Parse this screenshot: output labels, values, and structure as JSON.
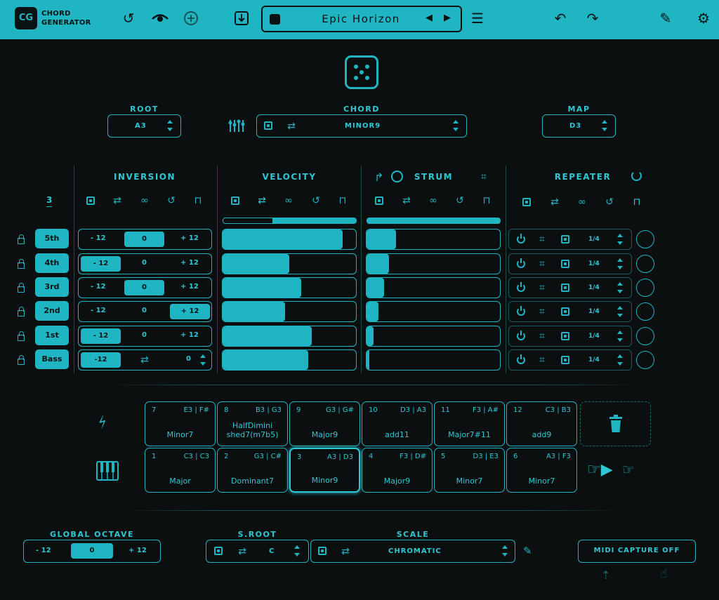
{
  "app": {
    "logo": "CG",
    "name_line1": "CHORD",
    "name_line2": "GENERATOR"
  },
  "preset": {
    "name": "Epic Horizon"
  },
  "root": {
    "label": "ROOT",
    "value": "A3"
  },
  "chord": {
    "label": "CHORD",
    "value": "MINOR9"
  },
  "map": {
    "label": "MAP",
    "value": "D3"
  },
  "sections": {
    "inversion": "INVERSION",
    "velocity": "VELOCITY",
    "strum": "STRUM",
    "repeater": "REPEATER"
  },
  "voice_count": "3",
  "voices": [
    {
      "label": "5th",
      "inv_low": "- 12",
      "inv_mid": "0",
      "inv_high": "+ 12",
      "inv_selected": "mid",
      "velocity": 0.9,
      "strum": 0.22,
      "rate": "1/4"
    },
    {
      "label": "4th",
      "inv_low": "- 12",
      "inv_mid": "0",
      "inv_high": "+ 12",
      "inv_selected": "low",
      "velocity": 0.5,
      "strum": 0.17,
      "rate": "1/4"
    },
    {
      "label": "3rd",
      "inv_low": "- 12",
      "inv_mid": "0",
      "inv_high": "+ 12",
      "inv_selected": "mid",
      "velocity": 0.59,
      "strum": 0.13,
      "rate": "1/4"
    },
    {
      "label": "2nd",
      "inv_low": "- 12",
      "inv_mid": "0",
      "inv_high": "+ 12",
      "inv_selected": "high",
      "velocity": 0.47,
      "strum": 0.09,
      "rate": "1/4"
    },
    {
      "label": "1st",
      "inv_low": "- 12",
      "inv_mid": "0",
      "inv_high": "+ 12",
      "inv_selected": "low",
      "velocity": 0.67,
      "strum": 0.05,
      "rate": "1/4"
    },
    {
      "label": "Bass",
      "inv_low": "-12",
      "inv_mid": "",
      "inv_high": "0",
      "inv_selected": "low",
      "velocity": 0.64,
      "strum": 0.0,
      "rate": "1/4"
    }
  ],
  "velocity_range": 0.37,
  "pads_top": [
    {
      "num": "7",
      "notes": "E3 | F#",
      "name": "Minor7"
    },
    {
      "num": "8",
      "notes": "B3 | G3",
      "name": "HalfDimini shed7(m7b5)"
    },
    {
      "num": "9",
      "notes": "G3 | G#",
      "name": "Major9"
    },
    {
      "num": "10",
      "notes": "D3 | A3",
      "name": "add11"
    },
    {
      "num": "11",
      "notes": "F3 | A#",
      "name": "Major7#11"
    },
    {
      "num": "12",
      "notes": "C3 | B3",
      "name": "add9"
    }
  ],
  "pads_bottom": [
    {
      "num": "1",
      "notes": "C3 | C3",
      "name": "Major"
    },
    {
      "num": "2",
      "notes": "G3 | C#",
      "name": "Dominant7"
    },
    {
      "num": "3",
      "notes": "A3 | D3",
      "name": "Minor9"
    },
    {
      "num": "4",
      "notes": "F3 | D#",
      "name": "Major9"
    },
    {
      "num": "5",
      "notes": "D3 | E3",
      "name": "Minor7"
    },
    {
      "num": "6",
      "notes": "A3 | F3",
      "name": "Minor7"
    }
  ],
  "active_pad": "3",
  "global_octave": {
    "label": "GLOBAL OCTAVE",
    "low": "- 12",
    "mid": "0",
    "high": "+ 12"
  },
  "sroot": {
    "label": "S.ROOT",
    "value": "C"
  },
  "scale": {
    "label": "SCALE",
    "value": "CHROMATIC"
  },
  "midi_capture": {
    "label": "MIDI CAPTURE OFF"
  },
  "colors": {
    "accent": "#1fb5c3",
    "background": "#0b0f10"
  }
}
